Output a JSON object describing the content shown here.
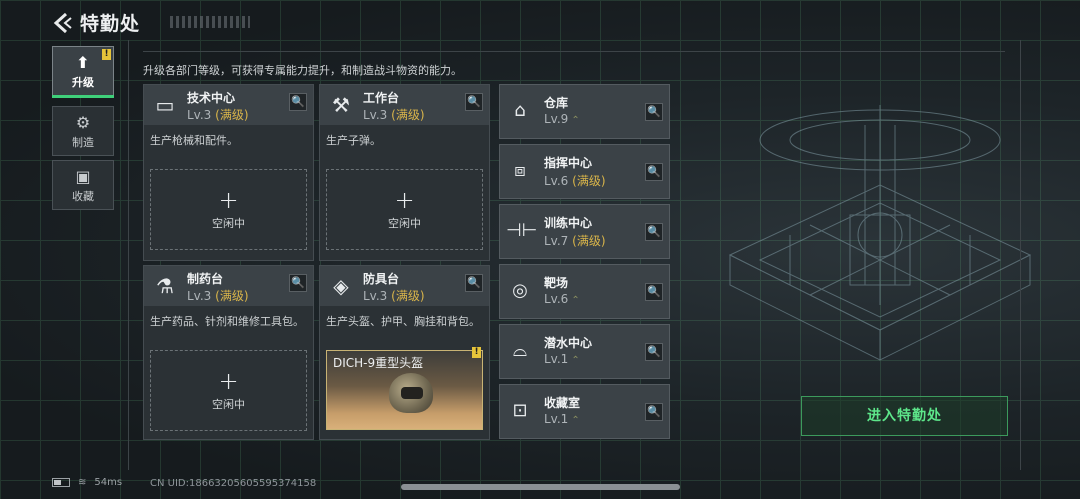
{
  "header": {
    "title": "特勤处"
  },
  "tabs": [
    {
      "label": "升级",
      "icon": "upgrade-icon",
      "active": true
    },
    {
      "label": "制造",
      "icon": "gears-icon",
      "active": false
    },
    {
      "label": "收藏",
      "icon": "collection-icon",
      "active": false
    }
  ],
  "description": "升级各部门等级，可获得专属能力提升，和制造战斗物资的能力。",
  "cards": [
    {
      "name": "技术中心",
      "level": "Lv.3",
      "max": "(满级)",
      "info": "生产枪械和配件。",
      "slot_plus": "+",
      "slot_text": "空闲中"
    },
    {
      "name": "工作台",
      "level": "Lv.3",
      "max": "(满级)",
      "info": "生产子弹。",
      "slot_plus": "+",
      "slot_text": "空闲中"
    },
    {
      "name": "制药台",
      "level": "Lv.3",
      "max": "(满级)",
      "info": "生产药品、针剂和维修工具包。",
      "slot_plus": "+",
      "slot_text": "空闲中"
    },
    {
      "name": "防具台",
      "level": "Lv.3",
      "max": "(满级)",
      "info": "生产头盔、护甲、胸挂和背包。",
      "item_name": "DICH-9重型头盔"
    }
  ],
  "list": [
    {
      "name": "仓库",
      "level": "Lv.9",
      "max": ""
    },
    {
      "name": "指挥中心",
      "level": "Lv.6",
      "max": "(满级)"
    },
    {
      "name": "训练中心",
      "level": "Lv.7",
      "max": "(满级)"
    },
    {
      "name": "靶场",
      "level": "Lv.6",
      "max": ""
    },
    {
      "name": "潜水中心",
      "level": "Lv.1",
      "max": ""
    },
    {
      "name": "收藏室",
      "level": "Lv.1",
      "max": ""
    }
  ],
  "enter_button": "进入特勤处",
  "status": {
    "ping": "54ms",
    "uid": "CN UID:18663205605595374158"
  },
  "badge": "!",
  "colors": {
    "accent": "#3fd07a",
    "max_level": "#d9b54a",
    "badge": "#e6c43a"
  }
}
